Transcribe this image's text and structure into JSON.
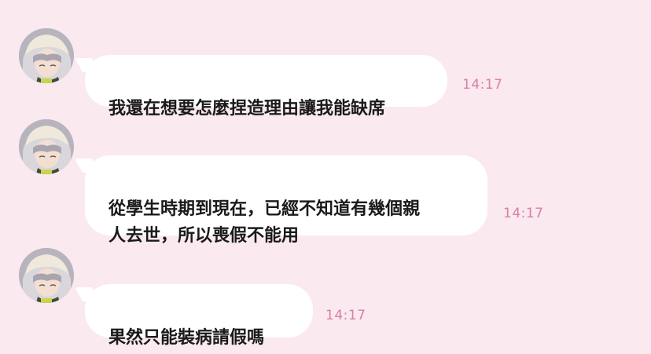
{
  "chat": {
    "messages": [
      {
        "text": "我還在想要怎麼捏造理由讓我能缺席",
        "time": "14:17",
        "avatar": "avatar-icon"
      },
      {
        "text": "從學生時期到現在，已經不知道有幾個親\n人去世，所以喪假不能用",
        "time": "14:17",
        "avatar": "avatar-icon"
      },
      {
        "text": "果然只能裝病請假嗎",
        "time": "14:17",
        "avatar": "avatar-icon"
      }
    ]
  },
  "colors": {
    "background": "#fbe9f0",
    "bubble": "#ffffff",
    "text": "#1a1a1a",
    "timestamp": "#d77fa6"
  }
}
